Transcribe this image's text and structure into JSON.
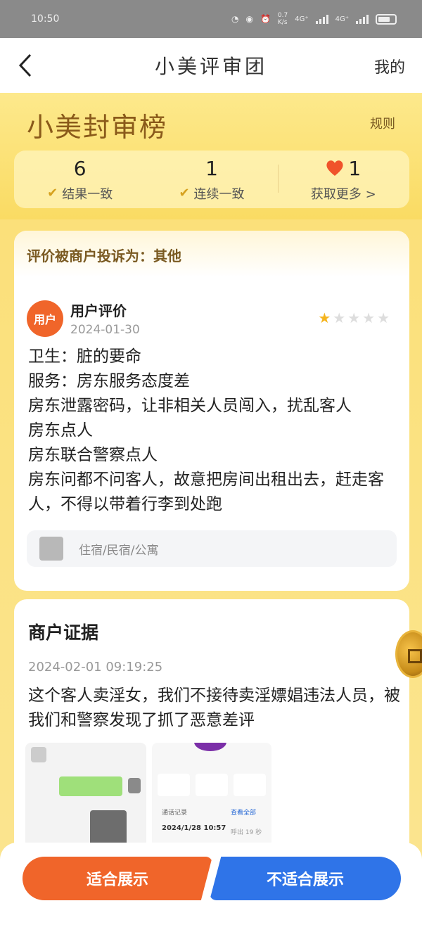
{
  "status_bar": {
    "time": "10:50",
    "network_speed": "0.7\nK/s",
    "net1": "4G⁺",
    "net2": "4G⁺"
  },
  "nav": {
    "title": "小美评审团",
    "right_label": "我的"
  },
  "header": {
    "brand": "小美封审榜",
    "rules_label": "规则",
    "stats": [
      {
        "value": "6",
        "label": "结果一致"
      },
      {
        "value": "1",
        "label": "连续一致"
      },
      {
        "value": "1",
        "label": "获取更多 >"
      }
    ]
  },
  "review_card": {
    "complaint": "评价被商户投诉为：其他",
    "avatar_text": "用户",
    "title": "用户评价",
    "date": "2024-01-30",
    "rating": 1,
    "rating_max": 5,
    "lines": [
      "卫生：脏的要命",
      "服务：房东服务态度差",
      "房东泄露密码，让非相关人员闯入，扰乱客人",
      "房东点人",
      "房东联合警察点人",
      "房东问都不问客人，故意把房间出租出去，赶走客人，不得以带着行李到处跑"
    ],
    "category": "住宿/民宿/公寓"
  },
  "evidence_card": {
    "title": "商户证据",
    "time": "2024-02-01 09:19:25",
    "text": "这个客人卖淫女，我们不接待卖淫嫖娼违法人员，被我们和警察发现了抓了恶意差评",
    "thumb_b": {
      "record_label": "通话记录",
      "record_date": "2024/1/28 10:57",
      "view_all": "查看全部",
      "duration": "呼出 19 秒"
    }
  },
  "actions": {
    "approve": "适合展示",
    "reject": "不适合展示"
  },
  "colors": {
    "accent_orange": "#f0652a",
    "accent_blue": "#2f74e8",
    "brand_gold": "#8a5a1a"
  },
  "icons": [
    "back-icon",
    "check-icon",
    "double-check-icon",
    "heart-icon",
    "star-icon",
    "category-icon",
    "coin-icon"
  ]
}
